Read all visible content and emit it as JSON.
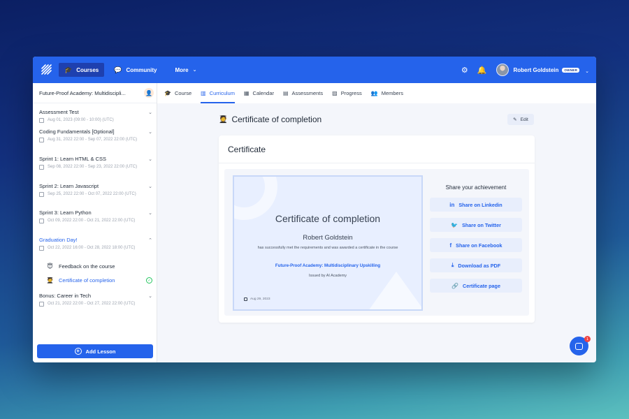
{
  "topbar": {
    "nav": [
      {
        "label": "Courses",
        "icon": "graduation-cap-icon"
      },
      {
        "label": "Community",
        "icon": "chat-icon"
      },
      {
        "label": "More",
        "icon": "chevron-down-icon"
      }
    ],
    "user_name": "Robert Goldstein",
    "user_badge": "OWNER"
  },
  "sidebar": {
    "course_title": "Future-Proof Academy: Multidiscipli...",
    "sections": [
      {
        "name": "Assessment Test",
        "date": "Aug 01, 2023 (09:00 - 10:00) (UTC)"
      },
      {
        "name": "Coding Fundamentals [Optional]",
        "date": "Aug 31, 2022 22:00 - Sep 07, 2022 22:00 (UTC)"
      },
      {
        "name": "Sprint 1: Learn HTML & CSS",
        "date": "Sep 08, 2022 22:00 - Sep 23, 2022 22:00 (UTC)"
      },
      {
        "name": "Sprint 2: Learn Javascript",
        "date": "Sep 25, 2022 22:00 - Oct 07, 2022 22:00 (UTC)"
      },
      {
        "name": "Sprint 3: Learn Python",
        "date": "Oct 09, 2022 22:00 - Oct 21, 2022 22:00 (UTC)"
      },
      {
        "name": "Graduation Day!",
        "date": "Oct 22, 2022 16:00 - Oct 28, 2022 18:00 (UTC)"
      },
      {
        "name": "Bonus: Career in Tech",
        "date": "Oct 21, 2022 22:00 - Oct 27, 2022 22:00 (UTC)"
      }
    ],
    "lessons": [
      {
        "label": "Feedback on the course",
        "emoji": "😇"
      },
      {
        "label": "Certificate of completion",
        "emoji": "🧑‍🎓"
      }
    ],
    "add_lesson": "Add Lesson"
  },
  "tabs": [
    "Course",
    "Curriculum",
    "Calendar",
    "Assessments",
    "Progress",
    "Members"
  ],
  "main": {
    "page_emoji": "🧑‍🎓",
    "page_title": "Certificate of completion",
    "edit_label": "Edit",
    "card_title": "Certificate",
    "certificate": {
      "title": "Certificate of completion",
      "name": "Robert Goldstein",
      "description": "has successfully met the requirements and was awarded a certificate in the course",
      "course": "Future-Proof Academy: Multidisciplinary Upskilling",
      "issued": "Issued by AI Academy",
      "date": "Aug 29, 2023"
    },
    "share": {
      "title": "Share your achievement",
      "buttons": [
        {
          "label": "Share on Linkedin",
          "icon": "linkedin-icon"
        },
        {
          "label": "Share on Twitter",
          "icon": "twitter-icon"
        },
        {
          "label": "Share on Facebook",
          "icon": "facebook-icon"
        },
        {
          "label": "Download as PDF",
          "icon": "download-icon"
        },
        {
          "label": "Certificate page",
          "icon": "link-icon"
        }
      ]
    }
  },
  "chat_badge": "1",
  "colors": {
    "primary": "#2563eb",
    "success": "#22c55e",
    "badge": "#ef4444"
  }
}
